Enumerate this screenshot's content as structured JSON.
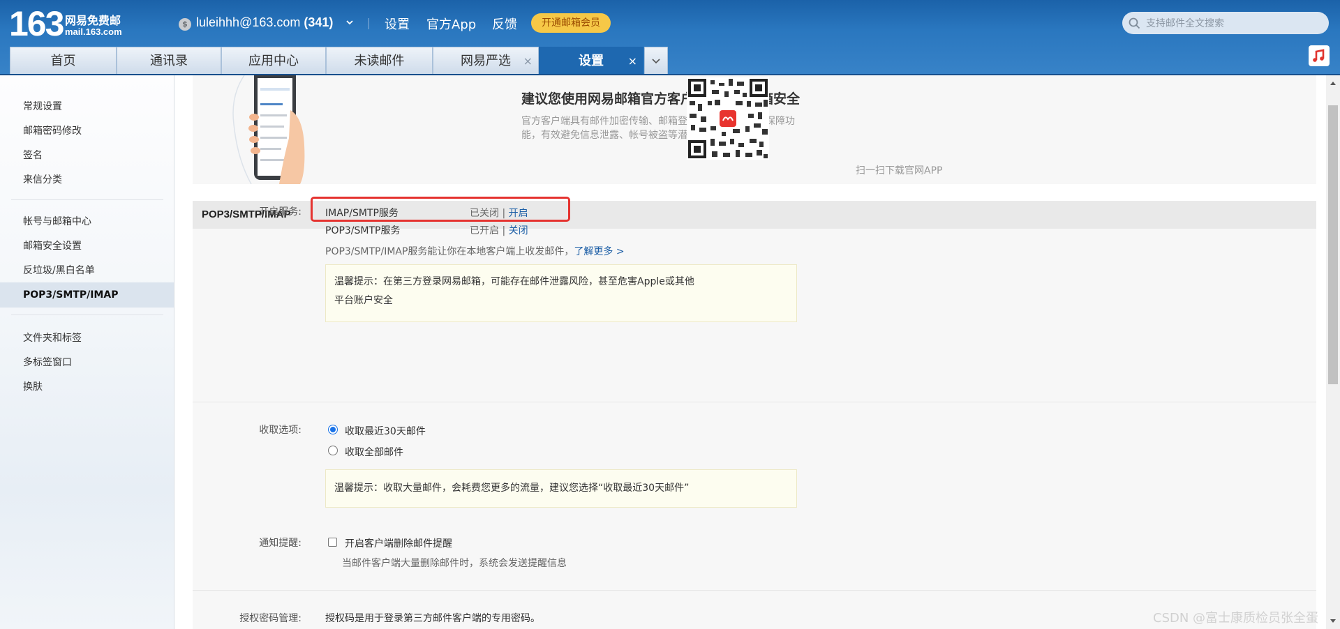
{
  "brand": {
    "number": "163",
    "name_cn": "网易免费邮",
    "domain": "mail.163.com"
  },
  "user": {
    "account": "luleihhh@163.com",
    "unread_count": "(341)"
  },
  "header_links": {
    "settings": "设置",
    "official_app": "官方App",
    "feedback": "反馈"
  },
  "vip_button": "开通邮箱会员",
  "search": {
    "placeholder": "支持邮件全文搜索"
  },
  "tabs": [
    {
      "label": "首页"
    },
    {
      "label": "通讯录"
    },
    {
      "label": "应用中心"
    },
    {
      "label": "未读邮件"
    },
    {
      "label": "网易严选",
      "close": "×"
    },
    {
      "label": "设置",
      "close": "×"
    }
  ],
  "sidebar": {
    "group1": [
      "常规设置",
      "邮箱密码修改",
      "签名",
      "来信分类"
    ],
    "group2": [
      "帐号与邮箱中心",
      "邮箱安全设置",
      "反垃圾/黑白名单",
      "POP3/SMTP/IMAP"
    ],
    "group3": [
      "文件夹和标签",
      "多标签窗口",
      "换肤"
    ]
  },
  "banner": {
    "title": "建议您使用网易邮箱官方客户端，确保邮箱安全",
    "desc": "官方客户端具有邮件加密传输、邮箱登录二次验证等安全保障功能，有效避免信息泄露、帐号被盗等潜在安全风险。",
    "qr_caption": "扫一扫下载官网APP"
  },
  "section": {
    "title": "POP3/SMTP/IMAP"
  },
  "services": {
    "label": "开启服务:",
    "imap": {
      "name": "IMAP/SMTP服务",
      "status": "已关闭",
      "sep": "|",
      "action": "开启"
    },
    "pop3": {
      "name": "POP3/SMTP服务",
      "status": "已开启",
      "sep": "|",
      "action": "关闭"
    },
    "note": "POP3/SMTP/IMAP服务能让你在本地客户端上收发邮件，",
    "learn_more": "了解更多 >",
    "tip_line1": "温馨提示：在第三方登录网易邮箱，可能存在邮件泄露风险，甚至危害Apple或其他",
    "tip_line2": "平台账户安全"
  },
  "receive": {
    "label": "收取选项:",
    "option1": "收取最近30天邮件",
    "option2": "收取全部邮件",
    "selected": "收取最近30天邮件",
    "tip": "温馨提示：收取大量邮件，会耗费您更多的流量，建议您选择“收取最近30天邮件”"
  },
  "notify": {
    "label": "通知提醒:",
    "checkbox": "开启客户端删除邮件提醒",
    "checked": false,
    "desc": "当邮件客户端大量删除邮件时，系统会发送提醒信息"
  },
  "auth": {
    "label": "授权密码管理:",
    "desc": "授权码是用于登录第三方邮件客户端的专用密码。"
  },
  "watermark": "CSDN @富士康质检员张全蛋",
  "colors": {
    "header_blue": "#2a77bf",
    "active_tab": "#1e68b0",
    "vip": "#f6c847",
    "link": "#1c5ea6",
    "highlight_red": "#e53330"
  }
}
